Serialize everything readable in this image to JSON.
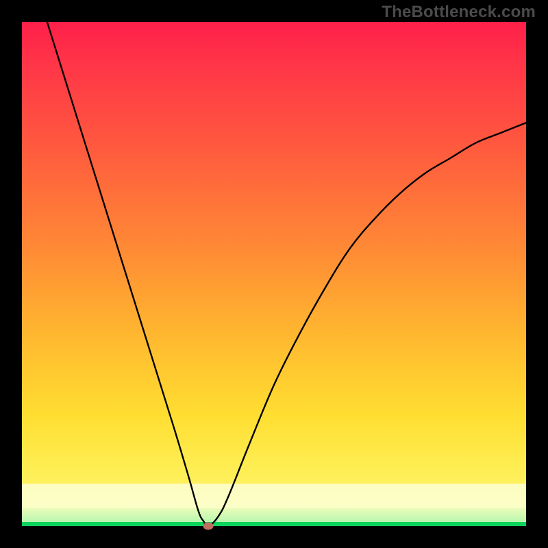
{
  "watermark": "TheBottleneck.com",
  "colors": {
    "frame": "#000000",
    "gradient_top": "#ff1f49",
    "gradient_mid": "#ffb72f",
    "gradient_low": "#fdf778",
    "band_pale_yellow": "#fbfec7",
    "band_pale_green": "#b9f6b0",
    "band_green": "#0bd35b",
    "curve": "#000000",
    "marker": "#be6f60"
  },
  "chart_data": {
    "type": "line",
    "title": "",
    "xlabel": "",
    "ylabel": "",
    "xlim": [
      0,
      100
    ],
    "ylim": [
      0,
      100
    ],
    "grid": false,
    "series": [
      {
        "name": "bottleneck-curve",
        "x": [
          5,
          10,
          15,
          20,
          25,
          30,
          33,
          35,
          36,
          37,
          39,
          41,
          45,
          50,
          55,
          60,
          65,
          70,
          75,
          80,
          85,
          90,
          95,
          100
        ],
        "values": [
          100,
          84,
          68,
          52,
          36,
          20,
          10,
          3,
          1,
          0,
          2,
          6,
          16,
          28,
          38,
          47,
          55,
          61,
          66,
          70,
          73,
          76,
          78,
          80
        ]
      }
    ],
    "marker": {
      "x": 37,
      "y": 0
    }
  }
}
